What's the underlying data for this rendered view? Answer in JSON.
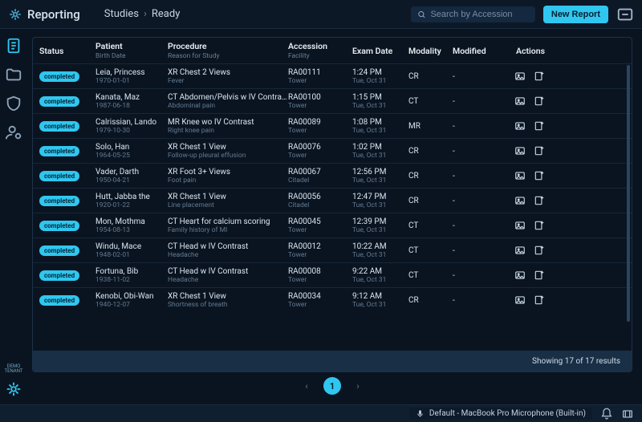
{
  "brand": "Reporting",
  "breadcrumb": {
    "root": "Studies",
    "current": "Ready"
  },
  "search": {
    "placeholder": "Search by Accession"
  },
  "new_report_label": "New Report",
  "columns": {
    "status": "Status",
    "patient": "Patient",
    "patient_sub": "Birth Date",
    "procedure": "Procedure",
    "procedure_sub": "Reason for Study",
    "accession": "Accession",
    "accession_sub": "Facility",
    "exam_date": "Exam Date",
    "modality": "Modality",
    "modified": "Modified",
    "actions": "Actions"
  },
  "rows": [
    {
      "status": "completed",
      "patient": "Leia, Princess",
      "birth": "1970-01-01",
      "procedure": "XR Chest 2 Views",
      "reason": "Fever",
      "accession": "RA00111",
      "facility": "Tower",
      "time": "1:24 PM",
      "date": "Tue, Oct 31",
      "modality": "CR",
      "modified": "-"
    },
    {
      "status": "completed",
      "patient": "Kanata, Maz",
      "birth": "1987-06-18",
      "procedure": "CT Abdomen/Pelvis w IV Contrast",
      "reason": "Abdominal pain",
      "accession": "RA00100",
      "facility": "Tower",
      "time": "1:15 PM",
      "date": "Tue, Oct 31",
      "modality": "CT",
      "modified": "-"
    },
    {
      "status": "completed",
      "patient": "Calrissian, Lando",
      "birth": "1979-10-30",
      "procedure": "MR Knee wo IV Contrast",
      "reason": "Right knee pain",
      "accession": "RA00089",
      "facility": "Tower",
      "time": "1:08 PM",
      "date": "Tue, Oct 31",
      "modality": "MR",
      "modified": "-"
    },
    {
      "status": "completed",
      "patient": "Solo, Han",
      "birth": "1964-05-25",
      "procedure": "XR Chest 1 View",
      "reason": "Follow-up pleural effusion",
      "accession": "RA00076",
      "facility": "Tower",
      "time": "1:02 PM",
      "date": "Tue, Oct 31",
      "modality": "CR",
      "modified": "-"
    },
    {
      "status": "completed",
      "patient": "Vader, Darth",
      "birth": "1950-04-21",
      "procedure": "XR Foot 3+ Views",
      "reason": "Foot pain",
      "accession": "RA00067",
      "facility": "Citadel",
      "time": "12:56 PM",
      "date": "Tue, Oct 31",
      "modality": "CR",
      "modified": "-"
    },
    {
      "status": "completed",
      "patient": "Hutt, Jabba the",
      "birth": "1920-01-22",
      "procedure": "XR Chest 1 View",
      "reason": "Line placement",
      "accession": "RA00056",
      "facility": "Citadel",
      "time": "12:47 PM",
      "date": "Tue, Oct 31",
      "modality": "CR",
      "modified": "-"
    },
    {
      "status": "completed",
      "patient": "Mon, Mothma",
      "birth": "1954-08-13",
      "procedure": "CT Heart for calcium scoring",
      "reason": "Family history of MI",
      "accession": "RA00045",
      "facility": "Tower",
      "time": "12:39 PM",
      "date": "Tue, Oct 31",
      "modality": "CT",
      "modified": "-"
    },
    {
      "status": "completed",
      "patient": "Windu, Mace",
      "birth": "1948-02-01",
      "procedure": "CT Head w IV Contrast",
      "reason": "Headache",
      "accession": "RA00012",
      "facility": "Tower",
      "time": "10:22 AM",
      "date": "Tue, Oct 31",
      "modality": "CT",
      "modified": "-"
    },
    {
      "status": "completed",
      "patient": "Fortuna, Bib",
      "birth": "1938-11-02",
      "procedure": "CT Head w IV Contrast",
      "reason": "Headache",
      "accession": "RA00008",
      "facility": "Tower",
      "time": "9:22 AM",
      "date": "Tue, Oct 31",
      "modality": "CT",
      "modified": "-"
    },
    {
      "status": "completed",
      "patient": "Kenobi, Obi-Wan",
      "birth": "1940-12-07",
      "procedure": "XR Chest 1 View",
      "reason": "Shortness of breath",
      "accession": "RA00034",
      "facility": "Tower",
      "time": "9:12 AM",
      "date": "Tue, Oct 31",
      "modality": "CR",
      "modified": "-"
    }
  ],
  "results_text": "Showing 17 of 17 results",
  "pager": {
    "current": "1"
  },
  "footer": {
    "mic": "Default - MacBook Pro Microphone (Built-in)"
  },
  "tenant": "DEMO\nTENANT"
}
